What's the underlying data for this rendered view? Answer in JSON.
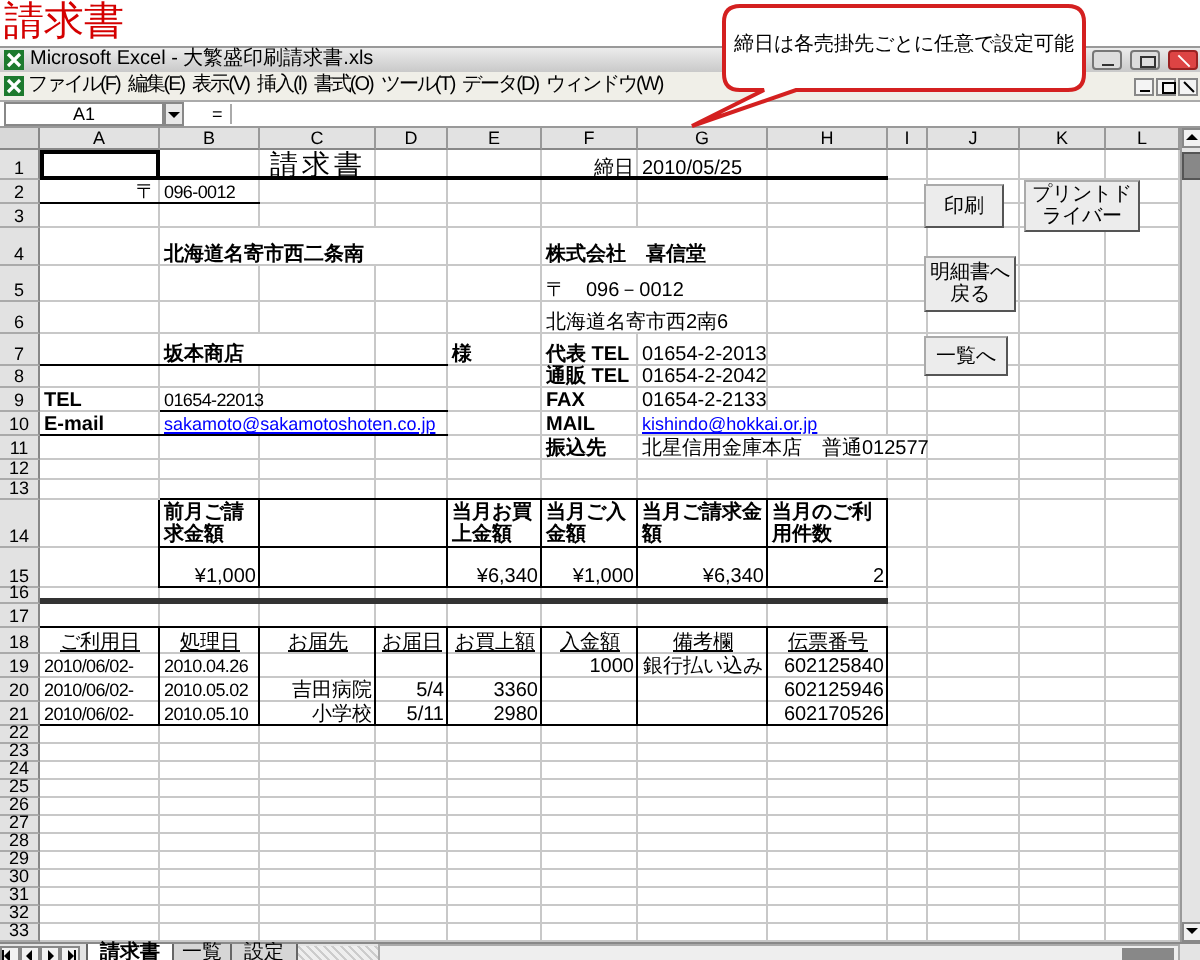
{
  "page_title": "請求書",
  "window": {
    "title": "Microsoft Excel - 大繁盛印刷請求書.xls"
  },
  "menu": [
    "ファイル(F)",
    "編集(E)",
    "表示(V)",
    "挿入(I)",
    "書式(O)",
    "ツール(T)",
    "データ(D)",
    "ウィンドウ(W)"
  ],
  "formula_bar": {
    "name_box": "A1",
    "equals": "="
  },
  "callout": {
    "text": "締日は各売掛先ごとに任意で設定可能"
  },
  "sheet": {
    "columns": [
      "A",
      "B",
      "C",
      "D",
      "E",
      "F",
      "G",
      "H",
      "I",
      "J",
      "K",
      "L"
    ],
    "rows": [
      {
        "number": "1",
        "cells": {
          "C": {
            "text": "請求書",
            "kind": "title"
          },
          "F": {
            "text": "締日",
            "kind": "right"
          },
          "G": {
            "text": "2010/05/25",
            "kind": "text"
          }
        }
      },
      {
        "number": "2",
        "cells": {
          "A": {
            "text": "〒",
            "kind": "right"
          },
          "B": {
            "text": "096-0012",
            "kind": "small"
          }
        }
      },
      {
        "number": "3"
      },
      {
        "number": "4",
        "cells": {
          "B": {
            "text": "北海道名寄市西二条南",
            "kind": "strong"
          },
          "F": {
            "text": "株式会社　喜信堂",
            "kind": "strong"
          }
        }
      },
      {
        "number": "5",
        "cells": {
          "F": {
            "text": "〒　096－0012",
            "kind": "text"
          }
        }
      },
      {
        "number": "6",
        "cells": {
          "F": {
            "text": "北海道名寄市西2南6",
            "kind": "text"
          }
        }
      },
      {
        "number": "7",
        "cells": {
          "B": {
            "text": "坂本商店",
            "kind": "strong"
          },
          "E": {
            "text": "様",
            "kind": "strong"
          },
          "F": {
            "text": "代表 TEL",
            "kind": "strong"
          },
          "G": {
            "text": "01654-2-2013",
            "kind": "text"
          }
        }
      },
      {
        "number": "8",
        "cells": {
          "F": {
            "text": "通販 TEL",
            "kind": "strong"
          },
          "G": {
            "text": "01654-2-2042",
            "kind": "text"
          }
        }
      },
      {
        "number": "9",
        "cells": {
          "A": {
            "text": "TEL",
            "kind": "strong"
          },
          "B": {
            "text": "01654-22013",
            "kind": "small"
          },
          "F": {
            "text": "FAX",
            "kind": "strong"
          },
          "G": {
            "text": "01654-2-2133",
            "kind": "text"
          }
        }
      },
      {
        "number": "10",
        "cells": {
          "A": {
            "text": "E-mail",
            "kind": "strong"
          },
          "B": {
            "text": "sakamoto@sakamotoshoten.co.jp",
            "kind": "link"
          },
          "F": {
            "text": "MAIL",
            "kind": "strong"
          },
          "G": {
            "text": "kishindo@hokkai.or.jp",
            "kind": "link"
          }
        }
      },
      {
        "number": "11",
        "cells": {
          "F": {
            "text": "振込先",
            "kind": "strong"
          },
          "G": {
            "text": "北星信用金庫本店　普通012577",
            "kind": "text"
          }
        }
      },
      {
        "number": "12"
      },
      {
        "number": "13"
      },
      {
        "number": "14",
        "cells": {
          "B": {
            "text": "前月ご請求金額",
            "kind": "caption"
          },
          "E": {
            "text": "当月お買上金額",
            "kind": "caption"
          },
          "F": {
            "text": "当月ご入金額",
            "kind": "caption"
          },
          "G": {
            "text": "当月ご請求金額",
            "kind": "caption"
          },
          "H": {
            "text": "当月のご利用件数",
            "kind": "caption"
          }
        }
      },
      {
        "number": "15",
        "cells": {
          "B": {
            "text": "¥1,000",
            "kind": "right"
          },
          "E": {
            "text": "¥6,340",
            "kind": "right"
          },
          "F": {
            "text": "¥1,000",
            "kind": "right"
          },
          "G": {
            "text": "¥6,340",
            "kind": "right"
          },
          "H": {
            "text": "2",
            "kind": "right"
          }
        }
      },
      {
        "number": "16"
      },
      {
        "number": "17"
      },
      {
        "number": "18",
        "cells": {
          "A": {
            "text": "ご利用日",
            "kind": "head"
          },
          "B": {
            "text": "処理日",
            "kind": "head"
          },
          "C": {
            "text": "お届先",
            "kind": "head"
          },
          "D": {
            "text": "お届日",
            "kind": "head"
          },
          "E": {
            "text": "お買上額",
            "kind": "head"
          },
          "F": {
            "text": "入金額",
            "kind": "head"
          },
          "G": {
            "text": "備考欄",
            "kind": "head"
          },
          "H": {
            "text": "伝票番号",
            "kind": "head"
          }
        }
      },
      {
        "number": "19",
        "cells": {
          "A": {
            "text": "2010/06/02-",
            "kind": "small"
          },
          "B": {
            "text": "2010.04.26",
            "kind": "small"
          },
          "F": {
            "text": "1000",
            "kind": "right"
          },
          "G": {
            "text": "銀行払い込み",
            "kind": "center"
          },
          "H": {
            "text": "602125840",
            "kind": "right"
          }
        }
      },
      {
        "number": "20",
        "cells": {
          "A": {
            "text": "2010/06/02-",
            "kind": "small"
          },
          "B": {
            "text": "2010.05.02",
            "kind": "small"
          },
          "C": {
            "text": "吉田病院",
            "kind": "right"
          },
          "D": {
            "text": "5/4",
            "kind": "right"
          },
          "E": {
            "text": "3360",
            "kind": "right"
          },
          "H": {
            "text": "602125946",
            "kind": "right"
          }
        }
      },
      {
        "number": "21",
        "cells": {
          "A": {
            "text": "2010/06/02-",
            "kind": "small"
          },
          "B": {
            "text": "2010.05.10",
            "kind": "small"
          },
          "C": {
            "text": "小学校",
            "kind": "right"
          },
          "D": {
            "text": "5/11",
            "kind": "right"
          },
          "E": {
            "text": "2980",
            "kind": "right"
          },
          "H": {
            "text": "602170526",
            "kind": "right"
          }
        }
      },
      {
        "number": "22"
      },
      {
        "number": "23"
      },
      {
        "number": "24"
      },
      {
        "number": "25"
      },
      {
        "number": "26"
      },
      {
        "number": "27"
      },
      {
        "number": "28"
      },
      {
        "number": "29"
      },
      {
        "number": "30"
      },
      {
        "number": "31"
      },
      {
        "number": "32"
      },
      {
        "number": "33"
      }
    ]
  },
  "sheet_buttons": [
    "印刷",
    "プリントドライバー",
    "明細書へ戻る",
    "一覧へ"
  ],
  "sheet_tabs": [
    {
      "label": "請求書",
      "selected": true
    },
    {
      "label": "一覧",
      "selected": false
    },
    {
      "label": "設定",
      "selected": false
    }
  ]
}
